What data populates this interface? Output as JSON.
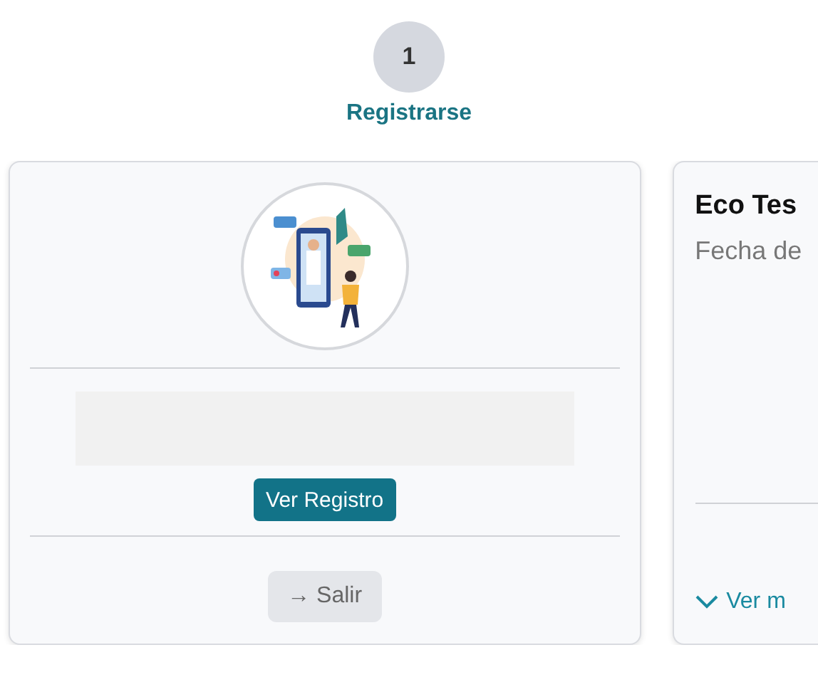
{
  "step": {
    "number": "1",
    "label": "Registrarse"
  },
  "profile_card": {
    "view_button": "Ver Registro",
    "exit_button": "→ Salir"
  },
  "test_card": {
    "title": "Eco Tes",
    "subtitle": "Fecha de",
    "expand_link": "Ver m",
    "expanded": false
  }
}
